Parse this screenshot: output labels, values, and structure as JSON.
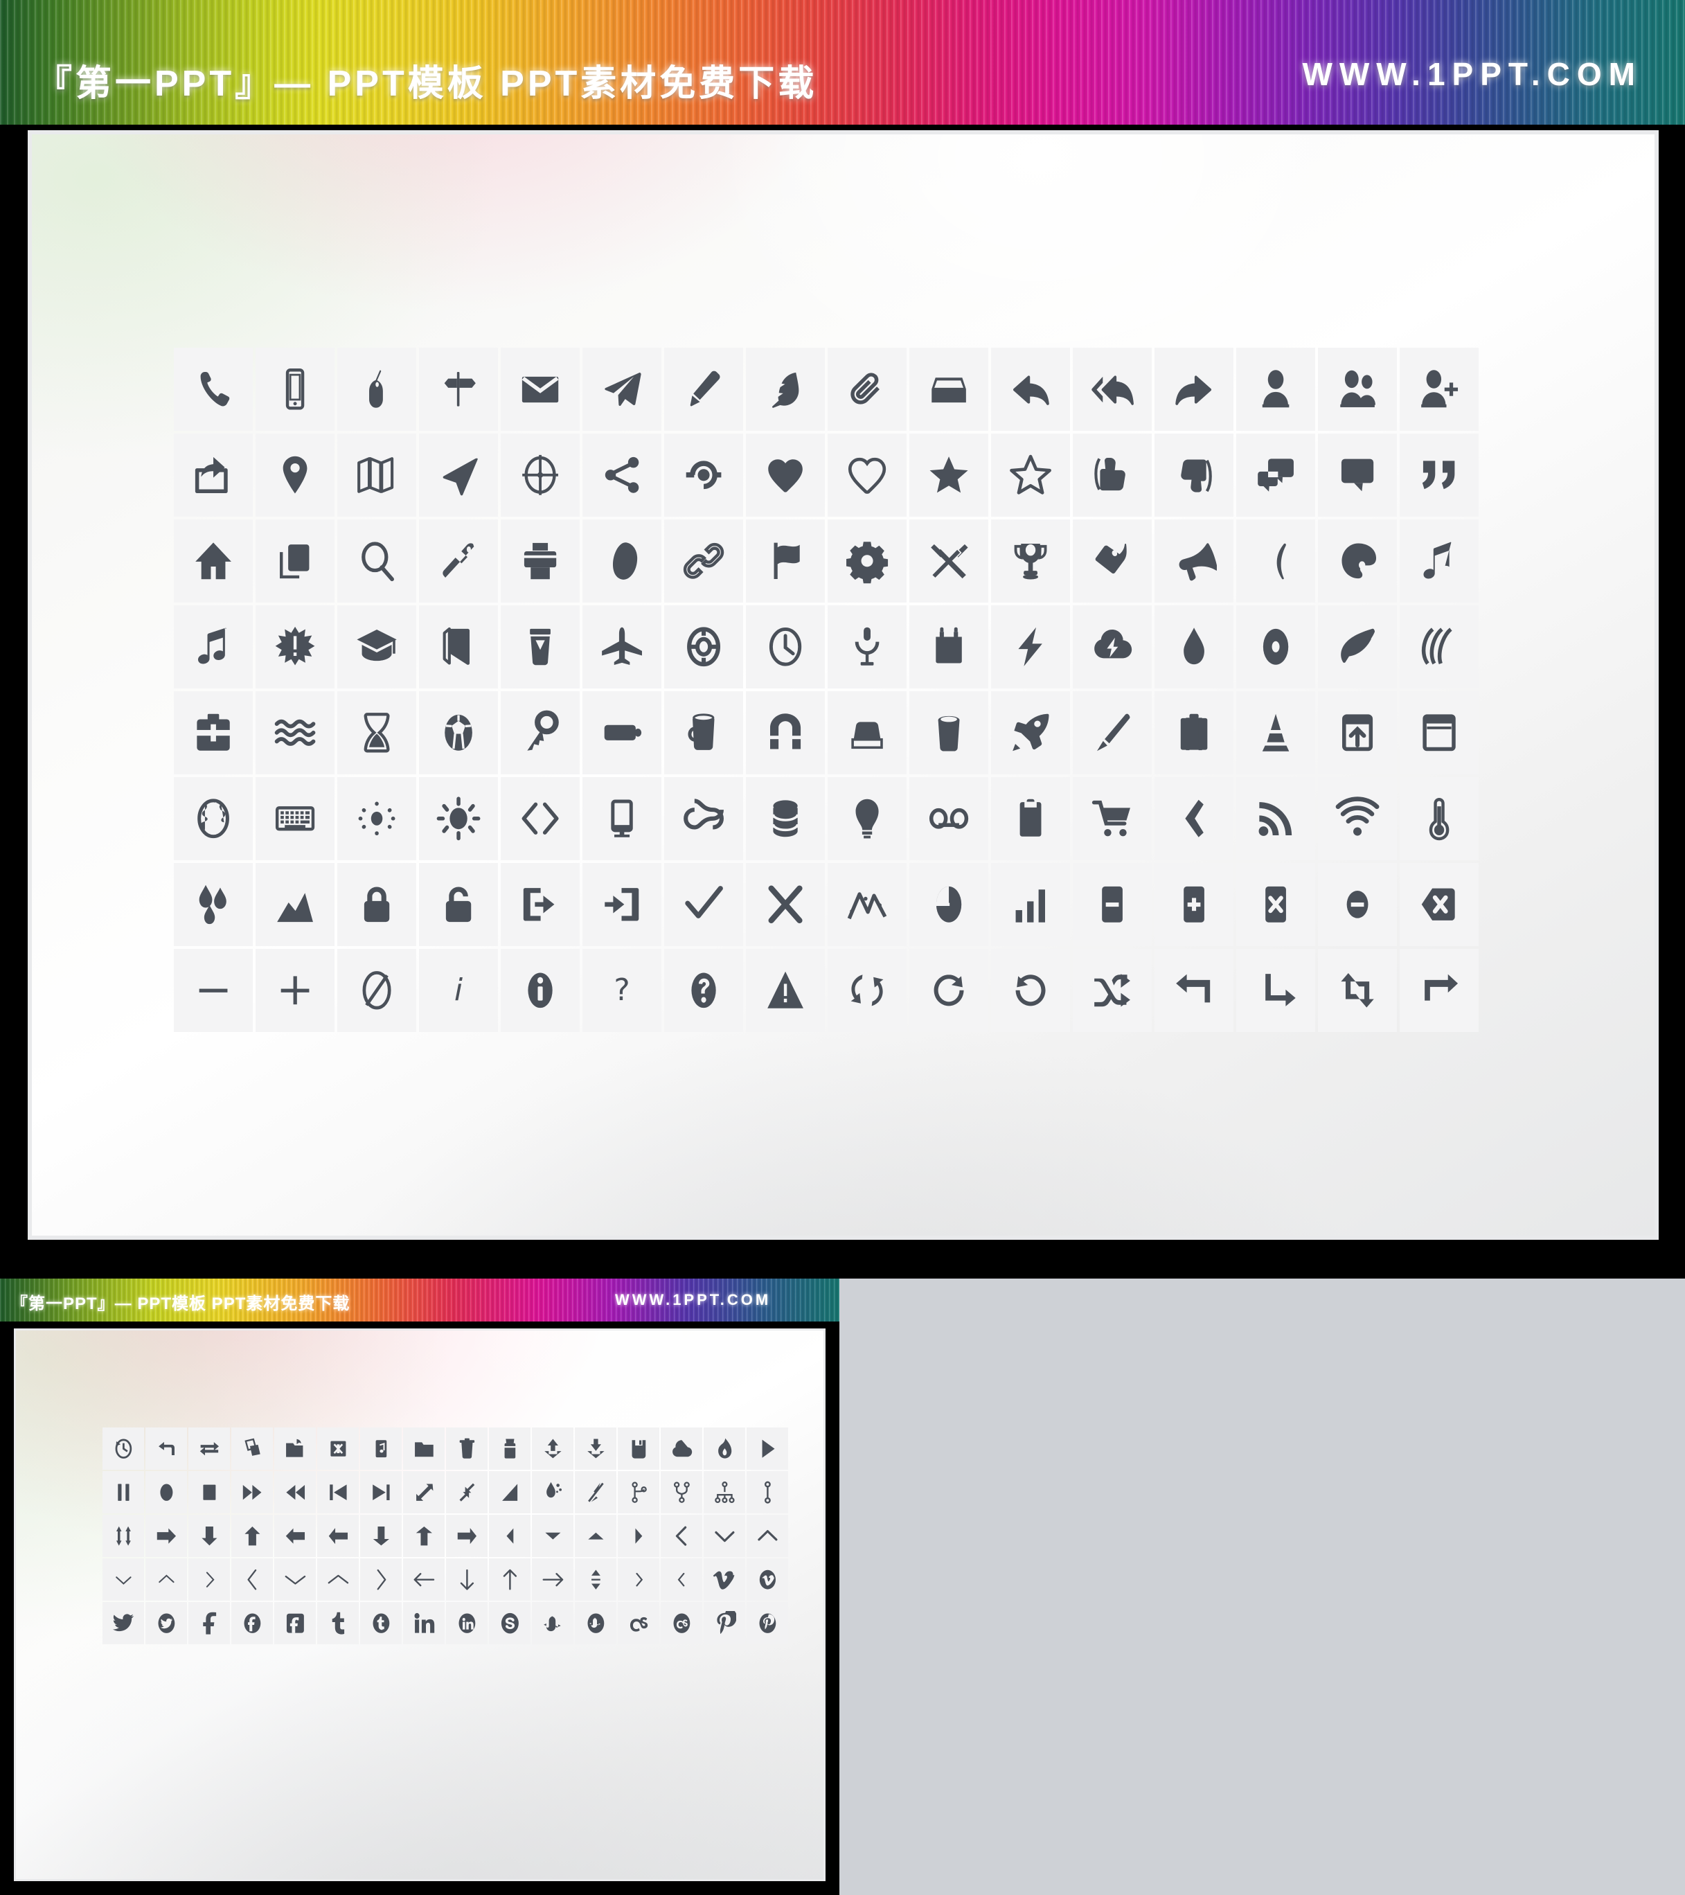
{
  "banner": {
    "title": "『第一PPT』— PPT模板 PPT素材免费下载",
    "url": "WWW.1PPT.COM"
  },
  "thumbnail_banner": {
    "title": "『第一PPT』— PPT模板 PPT素材免费下载",
    "url": "WWW.1PPT.COM"
  },
  "colors": {
    "icon": "#4a5059",
    "cell_background": "#f4f4f5",
    "slide_background": "#ffffff",
    "page_background": "#ced1d6",
    "frame_border": "#e9eaec"
  },
  "main_slide": {
    "columns": 16,
    "rows": 8,
    "icons": [
      "phone-icon",
      "mobile-icon",
      "mouse-icon",
      "signpost-icon",
      "envelope-icon",
      "paper-plane-icon",
      "pencil-icon",
      "feather-icon",
      "paperclip-icon",
      "inbox-icon",
      "reply-icon",
      "reply-all-icon",
      "forward-icon",
      "user-icon",
      "users-icon",
      "user-add-icon",
      "export-icon",
      "map-pin-icon",
      "map-icon",
      "navigation-icon",
      "target-icon",
      "share-icon",
      "share-alt-icon",
      "heart-icon",
      "heart-outline-icon",
      "star-icon",
      "star-outline-icon",
      "thumbs-up-icon",
      "thumbs-down-icon",
      "comments-icon",
      "comment-icon",
      "quote-icon",
      "home-icon",
      "layers-icon",
      "search-icon",
      "flashlight-icon",
      "printer-icon",
      "blob-icon",
      "link-icon",
      "flag-icon",
      "gear-icon",
      "tools-icon",
      "trophy-icon",
      "tag-icon",
      "megaphone-icon",
      "moon-icon",
      "palette-icon",
      "music-note-icon",
      "music-notes-icon",
      "starburst-icon",
      "graduation-cap-icon",
      "book-icon",
      "coffee-cup-icon",
      "airplane-icon",
      "life-ring-icon",
      "clock-icon",
      "microphone-icon",
      "calendar-icon",
      "lightning-icon",
      "cloud-lightning-icon",
      "droplet-icon",
      "disc-icon",
      "leaf-icon",
      "speedometer-icon",
      "first-aid-icon",
      "waves-icon",
      "hourglass-icon",
      "soccer-ball-icon",
      "key-icon",
      "battery-icon",
      "mug-icon",
      "magnet-icon",
      "eraser-icon",
      "trash-icon",
      "rocket-icon",
      "paintbrush-icon",
      "briefcase-icon",
      "traffic-cone-icon",
      "upload-box-icon",
      "window-icon",
      "globe-icon",
      "keyboard-icon",
      "brightness-low-icon",
      "brightness-high-icon",
      "code-icon",
      "monitor-icon",
      "infinity-icon",
      "database-icon",
      "lightbulb-icon",
      "voicemail-icon",
      "clipboard-icon",
      "shopping-cart-icon",
      "ticket-icon",
      "rss-icon",
      "wifi-icon",
      "thermometer-icon",
      "raindrops-icon",
      "chart-area-icon",
      "lock-icon",
      "unlock-icon",
      "logout-icon",
      "login-icon",
      "check-icon",
      "cross-icon",
      "line-chart-icon",
      "pie-chart-icon",
      "bar-chart-icon",
      "minus-square-icon",
      "plus-square-icon",
      "x-square-icon",
      "minus-circle-icon",
      "backspace-icon",
      "minus-icon",
      "plus-icon",
      "ban-icon",
      "info-italic-icon",
      "info-circle-icon",
      "question-icon",
      "question-circle-icon",
      "warning-icon",
      "sync-icon",
      "refresh-cw-icon",
      "refresh-ccw-icon",
      "shuffle-icon",
      "return-icon",
      "corner-down-right-icon",
      "retweet-icon",
      "repeat-icon"
    ]
  },
  "thumbnail_slide": {
    "columns": 16,
    "rows": 5,
    "icons": [
      "history-icon",
      "undo-icon",
      "swap-icon",
      "flip-icon",
      "folder-open-icon",
      "archive-box-icon",
      "folder-music-icon",
      "folder-icon",
      "trash-bin-icon",
      "drawer-icon",
      "upload-icon",
      "download-icon",
      "save-icon",
      "cloud-icon",
      "fire-icon",
      "play-icon",
      "pause-icon",
      "record-icon",
      "stop-icon",
      "fast-forward-icon",
      "rewind-icon",
      "skip-back-icon",
      "skip-forward-icon",
      "expand-icon",
      "collapse-icon",
      "volume-icon",
      "volume-drop-icon",
      "volume-mute-icon",
      "branch-icon",
      "fork-icon",
      "sitemap-icon",
      "pin-icon",
      "resize-vertical-icon",
      "arrow-left-fat-icon",
      "arrow-down-fat-icon",
      "arrow-up-fat-icon",
      "arrow-right-fat-icon",
      "arrow-left-solid-icon",
      "arrow-down-solid-icon",
      "arrow-up-solid-icon",
      "arrow-right-solid-icon",
      "caret-left-icon",
      "caret-down-icon",
      "caret-up-icon",
      "caret-right-icon",
      "chevron-left-icon",
      "chevron-down-icon",
      "chevron-up-icon",
      "chevron-down-thin-icon",
      "chevron-up-thin-icon",
      "chevron-right-thin-icon",
      "angle-left-icon",
      "angle-down-icon",
      "angle-up-icon",
      "angle-right-icon",
      "arrow-left-line-icon",
      "arrow-down-line-icon",
      "arrow-up-line-icon",
      "arrow-right-line-icon",
      "sort-icon",
      "angle-right-small-icon",
      "angle-left-small-icon",
      "vimeo-icon",
      "vimeo-circle-icon",
      "twitter-icon",
      "twitter-circle-icon",
      "facebook-icon",
      "facebook-circle-icon",
      "facebook-square-icon",
      "tumblr-icon",
      "tumblr-circle-icon",
      "linkedin-icon",
      "linkedin-circle-icon",
      "skype-icon",
      "stumbleupon-icon",
      "stumbleupon-circle-icon",
      "lastfm-icon",
      "lastfm-circle-icon",
      "pinterest-icon",
      "pinterest-circle-icon"
    ]
  }
}
